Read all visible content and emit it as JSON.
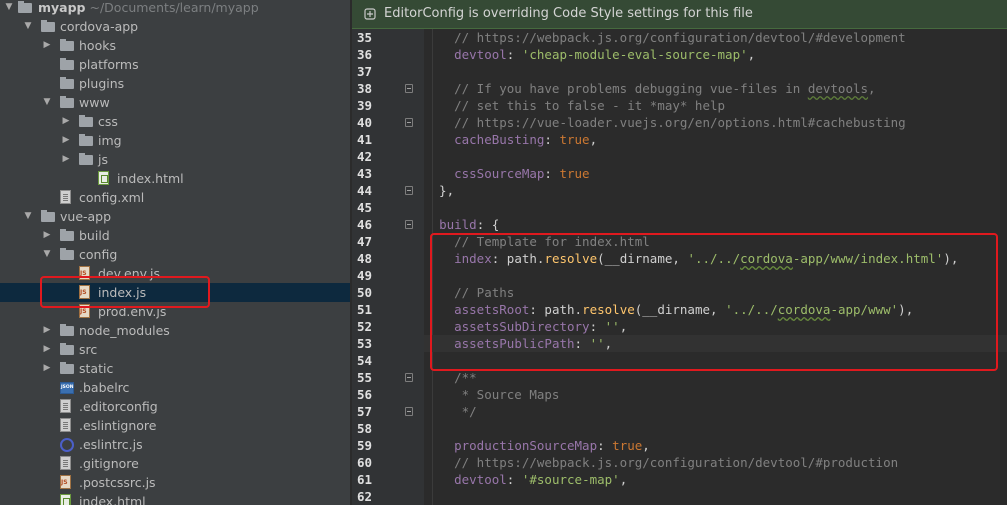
{
  "project": {
    "root_name": "myapp",
    "root_path": "~/Documents/learn/myapp",
    "tree": [
      {
        "label": "cordova-app",
        "type": "folder",
        "arrow": "▼",
        "depth": 1
      },
      {
        "label": "hooks",
        "type": "folder",
        "arrow": "▶",
        "depth": 2
      },
      {
        "label": "platforms",
        "type": "folder",
        "arrow": "",
        "depth": 2
      },
      {
        "label": "plugins",
        "type": "folder",
        "arrow": "",
        "depth": 2
      },
      {
        "label": "www",
        "type": "folder",
        "arrow": "▼",
        "depth": 2
      },
      {
        "label": "css",
        "type": "folder",
        "arrow": "▶",
        "depth": 3
      },
      {
        "label": "img",
        "type": "folder",
        "arrow": "▶",
        "depth": 3
      },
      {
        "label": "js",
        "type": "folder",
        "arrow": "▶",
        "depth": 3
      },
      {
        "label": "index.html",
        "type": "html",
        "arrow": "",
        "depth": 4
      },
      {
        "label": "config.xml",
        "type": "txt",
        "arrow": "",
        "depth": 2
      },
      {
        "label": "vue-app",
        "type": "folder",
        "arrow": "▼",
        "depth": 1
      },
      {
        "label": "build",
        "type": "folder",
        "arrow": "▶",
        "depth": 2
      },
      {
        "label": "config",
        "type": "folder",
        "arrow": "▼",
        "depth": 2
      },
      {
        "label": "dev.env.js",
        "type": "js",
        "arrow": "",
        "depth": 3
      },
      {
        "label": "index.js",
        "type": "js",
        "arrow": "",
        "depth": 3,
        "selected": true
      },
      {
        "label": "prod.env.js",
        "type": "js",
        "arrow": "",
        "depth": 3
      },
      {
        "label": "node_modules",
        "type": "folder",
        "arrow": "▶",
        "depth": 2
      },
      {
        "label": "src",
        "type": "folder",
        "arrow": "▶",
        "depth": 2
      },
      {
        "label": "static",
        "type": "folder",
        "arrow": "▶",
        "depth": 2
      },
      {
        "label": ".babelrc",
        "type": "json",
        "arrow": "",
        "depth": 2
      },
      {
        "label": ".editorconfig",
        "type": "txt",
        "arrow": "",
        "depth": 2
      },
      {
        "label": ".eslintignore",
        "type": "txt",
        "arrow": "",
        "depth": 2
      },
      {
        "label": ".eslintrc.js",
        "type": "circle",
        "arrow": "",
        "depth": 2
      },
      {
        "label": ".gitignore",
        "type": "txt",
        "arrow": "",
        "depth": 2
      },
      {
        "label": ".postcssrc.js",
        "type": "js",
        "arrow": "",
        "depth": 2
      },
      {
        "label": "index.html",
        "type": "html",
        "arrow": "",
        "depth": 2
      }
    ]
  },
  "editor": {
    "banner": "EditorConfig is overriding Code Style settings for this file",
    "caret_line": 53,
    "lines": [
      {
        "n": 35,
        "fold": false,
        "tokens": [
          [
            "c",
            "    // https://webpack.js.org/configuration/devtool/#development"
          ]
        ]
      },
      {
        "n": 36,
        "fold": false,
        "tokens": [
          [
            "p",
            "    "
          ],
          [
            "m",
            "devtool"
          ],
          [
            "p",
            ": "
          ],
          [
            "s",
            "'cheap-module-eval-source-map'"
          ],
          [
            "p",
            ","
          ]
        ]
      },
      {
        "n": 37,
        "fold": false,
        "tokens": []
      },
      {
        "n": 38,
        "fold": true,
        "tokens": [
          [
            "c",
            "    // If you have problems debugging vue-files in "
          ],
          [
            "cu",
            "devtools"
          ],
          [
            "c",
            ","
          ]
        ]
      },
      {
        "n": 39,
        "fold": false,
        "tokens": [
          [
            "c",
            "    // set this to false - it *may* help"
          ]
        ]
      },
      {
        "n": 40,
        "fold": true,
        "tokens": [
          [
            "c",
            "    // https://vue-loader.vuejs.org/en/options.html#cachebusting"
          ]
        ]
      },
      {
        "n": 41,
        "fold": false,
        "tokens": [
          [
            "p",
            "    "
          ],
          [
            "m",
            "cacheBusting"
          ],
          [
            "p",
            ": "
          ],
          [
            "k",
            "true"
          ],
          [
            "p",
            ","
          ]
        ]
      },
      {
        "n": 42,
        "fold": false,
        "tokens": []
      },
      {
        "n": 43,
        "fold": false,
        "tokens": [
          [
            "p",
            "    "
          ],
          [
            "m",
            "cssSourceMap"
          ],
          [
            "p",
            ": "
          ],
          [
            "k",
            "true"
          ]
        ]
      },
      {
        "n": 44,
        "fold": true,
        "tokens": [
          [
            "p",
            "  },"
          ]
        ]
      },
      {
        "n": 45,
        "fold": false,
        "tokens": []
      },
      {
        "n": 46,
        "fold": true,
        "tokens": [
          [
            "p",
            "  "
          ],
          [
            "m",
            "build"
          ],
          [
            "p",
            ": {"
          ]
        ]
      },
      {
        "n": 47,
        "fold": false,
        "tokens": [
          [
            "c",
            "    // Template for index.html"
          ]
        ]
      },
      {
        "n": 48,
        "fold": false,
        "tokens": [
          [
            "p",
            "    "
          ],
          [
            "m",
            "index"
          ],
          [
            "p",
            ": path."
          ],
          [
            "f",
            "resolve"
          ],
          [
            "p",
            "(__dirname, "
          ],
          [
            "s",
            "'../../"
          ],
          [
            "su",
            "cordova"
          ],
          [
            "s",
            "-app/www/index.html'"
          ],
          [
            "p",
            "),"
          ]
        ]
      },
      {
        "n": 49,
        "fold": false,
        "tokens": []
      },
      {
        "n": 50,
        "fold": false,
        "tokens": [
          [
            "c",
            "    // Paths"
          ]
        ]
      },
      {
        "n": 51,
        "fold": false,
        "tokens": [
          [
            "p",
            "    "
          ],
          [
            "m",
            "assetsRoot"
          ],
          [
            "p",
            ": path."
          ],
          [
            "f",
            "resolve"
          ],
          [
            "p",
            "(__dirname, "
          ],
          [
            "s",
            "'../../"
          ],
          [
            "su",
            "cordova"
          ],
          [
            "s",
            "-app/www'"
          ],
          [
            "p",
            "),"
          ]
        ]
      },
      {
        "n": 52,
        "fold": false,
        "tokens": [
          [
            "p",
            "    "
          ],
          [
            "m",
            "assetsSubDirectory"
          ],
          [
            "p",
            ": "
          ],
          [
            "s",
            "''"
          ],
          [
            "p",
            ","
          ]
        ]
      },
      {
        "n": 53,
        "fold": false,
        "tokens": [
          [
            "p",
            "    "
          ],
          [
            "m",
            "assetsPublicPath"
          ],
          [
            "p",
            ": "
          ],
          [
            "s",
            "''"
          ],
          [
            "p",
            ","
          ]
        ]
      },
      {
        "n": 54,
        "fold": false,
        "tokens": []
      },
      {
        "n": 55,
        "fold": true,
        "tokens": [
          [
            "c",
            "    /**"
          ]
        ]
      },
      {
        "n": 56,
        "fold": false,
        "tokens": [
          [
            "c",
            "     * Source Maps"
          ]
        ]
      },
      {
        "n": 57,
        "fold": true,
        "tokens": [
          [
            "c",
            "     */"
          ]
        ]
      },
      {
        "n": 58,
        "fold": false,
        "tokens": []
      },
      {
        "n": 59,
        "fold": false,
        "tokens": [
          [
            "p",
            "    "
          ],
          [
            "m",
            "productionSourceMap"
          ],
          [
            "p",
            ": "
          ],
          [
            "k",
            "true"
          ],
          [
            "p",
            ","
          ]
        ]
      },
      {
        "n": 60,
        "fold": false,
        "tokens": [
          [
            "c",
            "    // https://webpack.js.org/configuration/devtool/#production"
          ]
        ]
      },
      {
        "n": 61,
        "fold": false,
        "tokens": [
          [
            "p",
            "    "
          ],
          [
            "m",
            "devtool"
          ],
          [
            "p",
            ": "
          ],
          [
            "s",
            "'#source-map'"
          ],
          [
            "p",
            ","
          ]
        ]
      },
      {
        "n": 62,
        "fold": false,
        "tokens": []
      }
    ]
  },
  "colors": {
    "highlight_box": "#e0191e",
    "banner_bg": "#354a35",
    "selection": "#0d293e"
  }
}
